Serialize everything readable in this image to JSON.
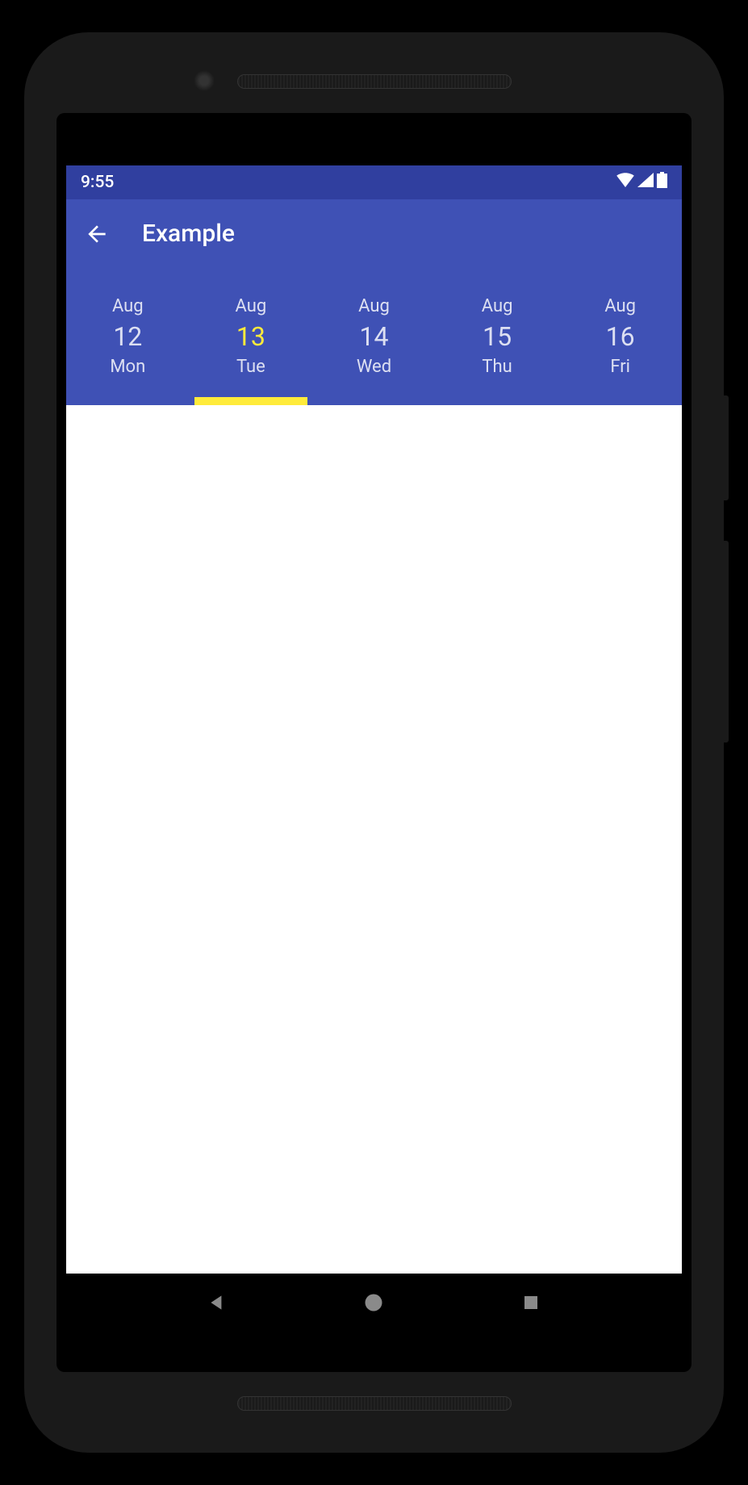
{
  "status": {
    "time": "9:55"
  },
  "appbar": {
    "title": "Example"
  },
  "dateTabs": {
    "selectedIndex": 1,
    "items": [
      {
        "month": "Aug",
        "day": "12",
        "weekday": "Mon"
      },
      {
        "month": "Aug",
        "day": "13",
        "weekday": "Tue"
      },
      {
        "month": "Aug",
        "day": "14",
        "weekday": "Wed"
      },
      {
        "month": "Aug",
        "day": "15",
        "weekday": "Thu"
      },
      {
        "month": "Aug",
        "day": "16",
        "weekday": "Fri"
      }
    ]
  }
}
